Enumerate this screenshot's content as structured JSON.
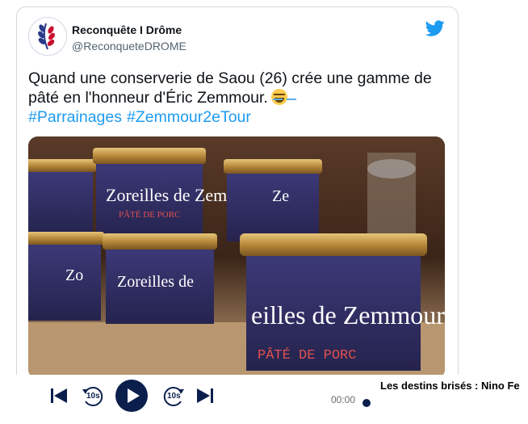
{
  "tweet": {
    "display_name": "Reconquête I Drôme",
    "handle": "@ReconqueteDROME",
    "text": "Quand une conserverie de Saou (26) crée une gamme de pâté en l'honneur d'Éric Zemmour.",
    "emoji_icon": "face-with-tears-of-joy-icon",
    "hashtags": [
      "#Parrainages",
      "#Zemmour2eTour"
    ],
    "image": {
      "jar_label_text": "Zoreilles de Zemmour",
      "jar_sub_label": "PÂTÉ DE PORC",
      "front_jar_text": "eilles de Zemmour",
      "front_jar_sub": "PÂTÉ DE PORC"
    }
  },
  "player": {
    "previous_icon": "skip-previous-icon",
    "rewind_label": "10s",
    "play_icon": "play-icon",
    "forward_label": "10s",
    "next_icon": "skip-next-icon",
    "time": "00:00",
    "episode_title": "Les destins brisés : Nino Fe"
  },
  "colors": {
    "accent_blue": "#1d9bf0",
    "player_navy": "#0b1f4d"
  }
}
